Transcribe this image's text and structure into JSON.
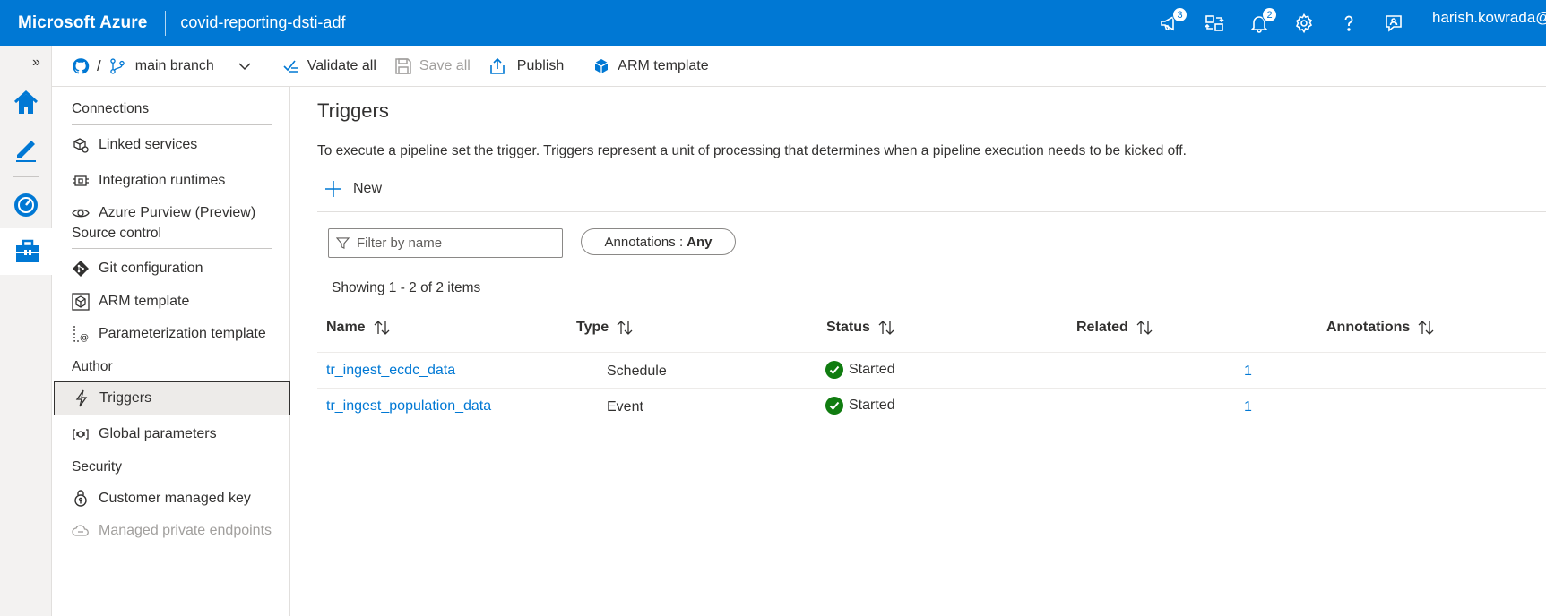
{
  "header": {
    "brand": "Microsoft Azure",
    "factory_name": "covid-reporting-dsti-adf",
    "notifications_badge_a": "3",
    "notifications_badge_b": "2",
    "user": "harish.kowrada@"
  },
  "toolbar": {
    "branch": "main branch",
    "separator": "/",
    "validate_all": "Validate all",
    "save_all": "Save all",
    "publish": "Publish",
    "arm_template": "ARM template"
  },
  "sidenav": {
    "connections_header": "Connections",
    "linked_services": "Linked services",
    "integration_runtimes": "Integration runtimes",
    "azure_purview": "Azure Purview (Preview)",
    "source_control_header": "Source control",
    "git_configuration": "Git configuration",
    "arm_template": "ARM template",
    "parameterization_template": "Parameterization template",
    "author_header": "Author",
    "triggers": "Triggers",
    "global_parameters": "Global parameters",
    "security_header": "Security",
    "customer_managed_key": "Customer managed key",
    "managed_private_endpoints": "Managed private endpoints"
  },
  "main": {
    "title": "Triggers",
    "description": "To execute a pipeline set the trigger. Triggers represent a unit of processing that determines when a pipeline execution needs to be kicked off.",
    "new_label": "New",
    "filter_placeholder": "Filter by name",
    "annotations_filter_label": "Annotations :",
    "annotations_filter_value": "Any",
    "showing": "Showing 1 - 2 of 2 items",
    "columns": {
      "name": "Name",
      "type": "Type",
      "status": "Status",
      "related": "Related",
      "annotations": "Annotations"
    },
    "rows": [
      {
        "name": "tr_ingest_ecdc_data",
        "type": "Schedule",
        "status": "Started",
        "related": "1",
        "annotations": ""
      },
      {
        "name": "tr_ingest_population_data",
        "type": "Event",
        "status": "Started",
        "related": "1",
        "annotations": ""
      }
    ]
  },
  "colors": {
    "azure_blue": "#0078d4",
    "status_green": "#107c10"
  }
}
